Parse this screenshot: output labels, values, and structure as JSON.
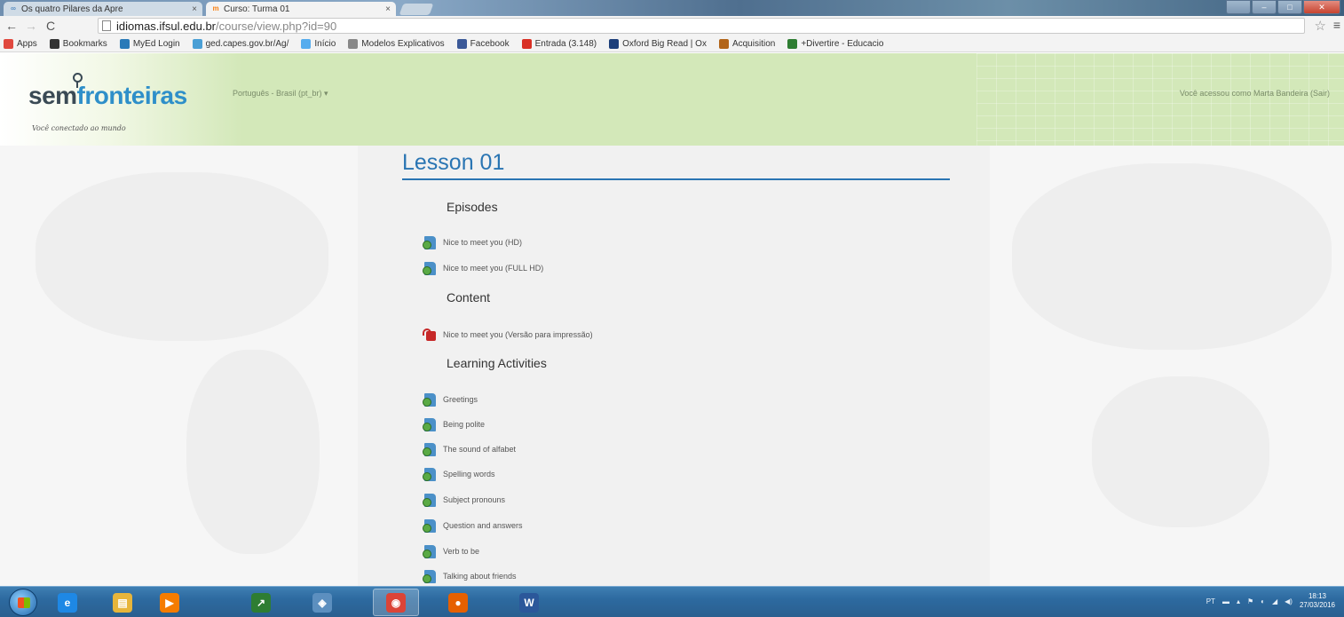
{
  "browser": {
    "tabs": [
      {
        "label": "Os quatro Pilares da Apre",
        "active": false
      },
      {
        "label": "Curso: Turma 01",
        "active": true
      }
    ],
    "url_host": "idiomas.ifsul.edu.br",
    "url_path": "/course/view.php?id=90",
    "bookmarks": [
      {
        "label": "Apps",
        "icon": "apps-grid-icon",
        "color": "#e0483e"
      },
      {
        "label": "Bookmarks",
        "icon": "star-icon",
        "color": "#333333"
      },
      {
        "label": "MyEd Login",
        "icon": "myed-icon",
        "color": "#2a7ab8"
      },
      {
        "label": "ged.capes.gov.br/Ag/",
        "icon": "capes-icon",
        "color": "#4a9fd5"
      },
      {
        "label": "Início",
        "icon": "twitter-icon",
        "color": "#55acee"
      },
      {
        "label": "Modelos Explicativos",
        "icon": "page-icon",
        "color": "#888888"
      },
      {
        "label": "Facebook",
        "icon": "facebook-icon",
        "color": "#3b5998"
      },
      {
        "label": "Entrada (3.148)",
        "icon": "gmail-icon",
        "color": "#d93025"
      },
      {
        "label": "Oxford Big Read | Ox",
        "icon": "oxford-icon",
        "color": "#1d3f7a"
      },
      {
        "label": "Acquisition",
        "icon": "acquisition-icon",
        "color": "#b2651a"
      },
      {
        "label": "+Divertire - Educacio",
        "icon": "divertire-icon",
        "color": "#2e7d32"
      }
    ]
  },
  "site": {
    "logo_sem": "sem",
    "logo_fronteiras": "fronteiras",
    "tagline": "Você conectado ao mundo",
    "language": "Português - Brasil (pt_br) ▾",
    "user_info": "Você acessou como Marta Bandeira (Sair)"
  },
  "course": {
    "title": "Lesson 01",
    "sections": [
      {
        "heading": "Episodes",
        "items": [
          {
            "label": "Nice to meet you (HD)",
            "type": "url"
          },
          {
            "label": "Nice to meet you (FULL HD)",
            "type": "url"
          }
        ]
      },
      {
        "heading": "Content",
        "items": [
          {
            "label": "Nice to meet you (Versão para impressão)",
            "type": "pdf"
          }
        ]
      },
      {
        "heading": "Learning Activities",
        "items": [
          {
            "label": "Greetings",
            "type": "url"
          },
          {
            "label": "Being polite",
            "type": "url"
          },
          {
            "label": "The sound of alfabet",
            "type": "url"
          },
          {
            "label": "Spelling words",
            "type": "url"
          },
          {
            "label": "Subject pronouns",
            "type": "url"
          },
          {
            "label": "Question and answers",
            "type": "url"
          },
          {
            "label": "Verb to be",
            "type": "url"
          },
          {
            "label": "Talking about friends",
            "type": "url"
          }
        ]
      }
    ]
  },
  "taskbar": {
    "apps": [
      {
        "name": "internet-explorer",
        "icon": "ie-icon",
        "color": "#1e88e5",
        "glyph": "e"
      },
      {
        "name": "file-explorer",
        "icon": "folder-icon",
        "color": "#e7b53b",
        "glyph": "▤"
      },
      {
        "name": "media-player",
        "icon": "media-player-icon",
        "color": "#f57c00",
        "glyph": "▶"
      },
      {
        "name": "task-manager",
        "icon": "chart-icon",
        "color": "#2e7d32",
        "glyph": "↗"
      },
      {
        "name": "network",
        "icon": "network-icon",
        "color": "#5c8fbf",
        "glyph": "◈"
      },
      {
        "name": "chrome",
        "icon": "chrome-icon",
        "color": "#db4437",
        "glyph": "◉"
      },
      {
        "name": "firefox",
        "icon": "firefox-icon",
        "color": "#e66000",
        "glyph": "●"
      },
      {
        "name": "word",
        "icon": "word-icon",
        "color": "#2b579a",
        "glyph": "W"
      }
    ],
    "tray_lang": "PT",
    "time": "18:13",
    "date": "27/03/2016"
  }
}
